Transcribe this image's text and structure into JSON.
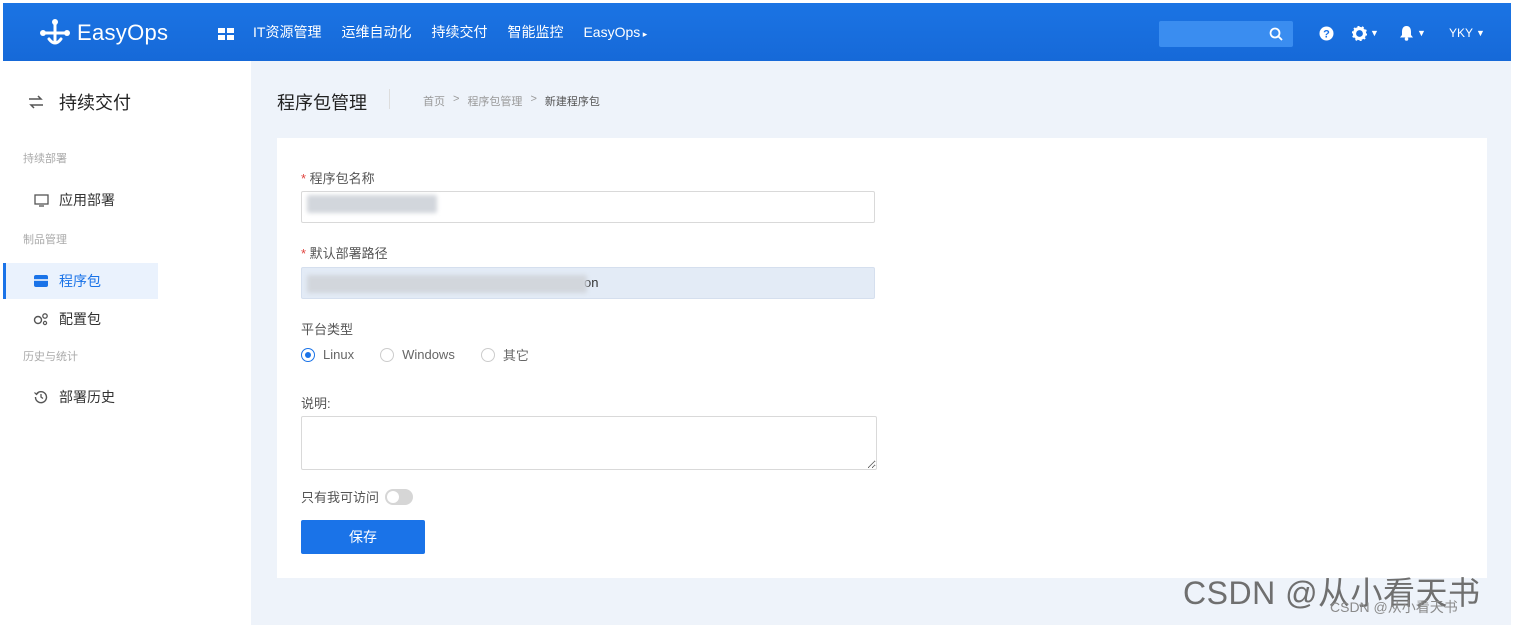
{
  "header": {
    "brand": "EasyOps",
    "nav": [
      "IT资源管理",
      "运维自动化",
      "持续交付",
      "智能监控",
      "EasyOps"
    ],
    "search_placeholder": "",
    "user": "YKY"
  },
  "sidebar": {
    "title": "持续交付",
    "groups": [
      "持续部署",
      "制品管理",
      "历史与统计"
    ],
    "items": [
      {
        "label": "应用部署",
        "icon": "monitor-icon"
      },
      {
        "label": "程序包",
        "icon": "package-icon",
        "active": true
      },
      {
        "label": "配置包",
        "icon": "config-icon"
      },
      {
        "label": "部署历史",
        "icon": "history-icon"
      }
    ]
  },
  "main": {
    "title": "程序包管理",
    "breadcrumb": [
      "首页",
      "程序包管理",
      "新建程序包"
    ],
    "form": {
      "name_label": "程序包名称",
      "name_value": "",
      "path_label": "默认部署路径",
      "path_value_suffix": "on",
      "platform_label": "平台类型",
      "platform_options": [
        "Linux",
        "Windows",
        "其它"
      ],
      "platform_selected": "Linux",
      "desc_label": "说明",
      "private_label": "只有我可访问",
      "save_label": "保存"
    }
  },
  "watermark": {
    "big": "CSDN @从小看天书",
    "small": "CSDN @从小看天书"
  },
  "colors": {
    "primary": "#1a73e8",
    "required": "#e0443f"
  }
}
